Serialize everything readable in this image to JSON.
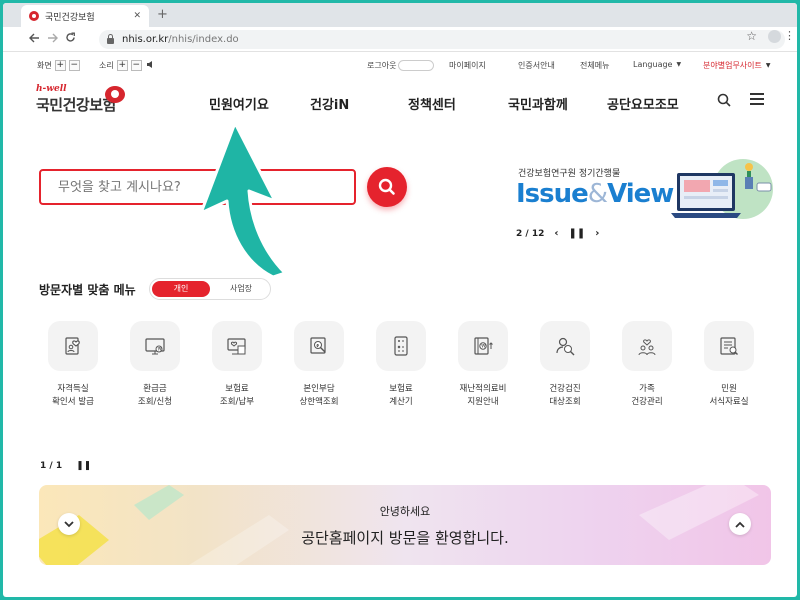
{
  "browser": {
    "tab_title": "국민건강보험",
    "tab_close": "✕",
    "new_tab": "+",
    "url_host": "nhis.or.kr",
    "url_path": "/nhis/index.do"
  },
  "util": {
    "screen_label": "화면",
    "sound_label": "소리",
    "plus": "+",
    "minus": "−",
    "logout": "로그아웃",
    "mypage": "마이페이지",
    "cert": "인증서안내",
    "allmenu": "전체메뉴",
    "language": "Language",
    "sites": "분야별업무사이트"
  },
  "logo": {
    "hwell": "h-well",
    "name": "국민건강보험"
  },
  "gnb": [
    "민원여기요",
    "건강iN",
    "정책센터",
    "국민과함께",
    "공단요모조모"
  ],
  "search": {
    "placeholder": "무엇을 찾고 계시나요?"
  },
  "issue": {
    "sub": "건강보험연구원 정기간행물",
    "word1": "Issue",
    "amp": "&",
    "word2": "View",
    "pager": "2 / 12"
  },
  "menu": {
    "title": "방문자별 맞춤 메뉴",
    "toggle_on": "개인",
    "toggle_off": "사업장",
    "items": [
      {
        "l1": "자격득실",
        "l2": "확인서 발급",
        "icon": "certificate-heart-icon"
      },
      {
        "l1": "환급금",
        "l2": "조회/신청",
        "icon": "refund-monitor-icon"
      },
      {
        "l1": "보험료",
        "l2": "조회/납부",
        "icon": "premium-payment-icon"
      },
      {
        "l1": "본인부담",
        "l2": "상한액조회",
        "icon": "copay-search-icon"
      },
      {
        "l1": "보험료",
        "l2": "계산기",
        "icon": "calculator-icon"
      },
      {
        "l1": "재난적의료비",
        "l2": "지원안내",
        "icon": "medical-aid-icon"
      },
      {
        "l1": "건강검진",
        "l2": "대상조회",
        "icon": "checkup-search-icon"
      },
      {
        "l1": "가족",
        "l2": "건강관리",
        "icon": "family-health-icon"
      },
      {
        "l1": "민원",
        "l2": "서식자료실",
        "icon": "form-library-icon"
      }
    ],
    "pager": "1 / 1"
  },
  "banner": {
    "hello": "안녕하세요",
    "welcome": "공단홈페이지 방문을 환영합니다."
  },
  "colors": {
    "accent": "#e5232d",
    "frame": "#21b8a8",
    "arrow": "#1fb5a5",
    "issue_blue": "#1a7fd0"
  }
}
